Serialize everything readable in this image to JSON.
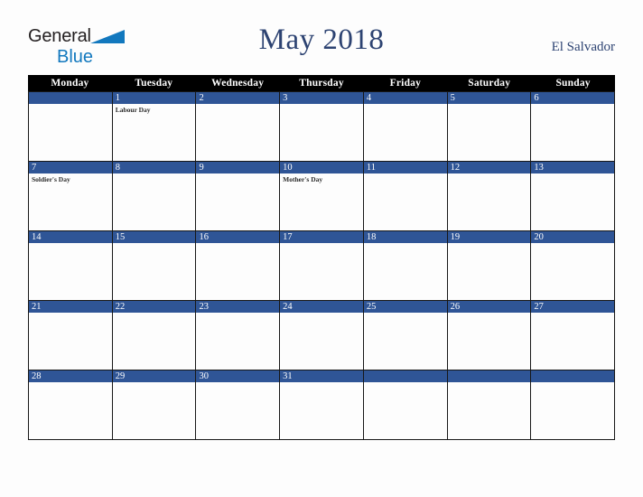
{
  "brand": {
    "word1": "General",
    "word2": "Blue",
    "color_dark": "#231f20",
    "color_blue": "#1278be",
    "triangle_icon": "triangle-icon"
  },
  "header": {
    "title": "May 2018",
    "country": "El Salvador",
    "title_color": "#2d4372"
  },
  "calendar": {
    "weekday_headers": [
      "Monday",
      "Tuesday",
      "Wednesday",
      "Thursday",
      "Friday",
      "Saturday",
      "Sunday"
    ],
    "header_bg": "#000000",
    "header_fg": "#ffffff",
    "daybar_bg": "#2f5596",
    "daybar_fg": "#ffffff",
    "cell_bg": "#fdfdfd",
    "grid_line": "#171717",
    "weeks": [
      [
        {
          "day": "",
          "events": []
        },
        {
          "day": "1",
          "events": [
            "Labour Day"
          ]
        },
        {
          "day": "2",
          "events": []
        },
        {
          "day": "3",
          "events": []
        },
        {
          "day": "4",
          "events": []
        },
        {
          "day": "5",
          "events": []
        },
        {
          "day": "6",
          "events": []
        }
      ],
      [
        {
          "day": "7",
          "events": [
            "Soldier's Day"
          ]
        },
        {
          "day": "8",
          "events": []
        },
        {
          "day": "9",
          "events": []
        },
        {
          "day": "10",
          "events": [
            "Mother's Day"
          ]
        },
        {
          "day": "11",
          "events": []
        },
        {
          "day": "12",
          "events": []
        },
        {
          "day": "13",
          "events": []
        }
      ],
      [
        {
          "day": "14",
          "events": []
        },
        {
          "day": "15",
          "events": []
        },
        {
          "day": "16",
          "events": []
        },
        {
          "day": "17",
          "events": []
        },
        {
          "day": "18",
          "events": []
        },
        {
          "day": "19",
          "events": []
        },
        {
          "day": "20",
          "events": []
        }
      ],
      [
        {
          "day": "21",
          "events": []
        },
        {
          "day": "22",
          "events": []
        },
        {
          "day": "23",
          "events": []
        },
        {
          "day": "24",
          "events": []
        },
        {
          "day": "25",
          "events": []
        },
        {
          "day": "26",
          "events": []
        },
        {
          "day": "27",
          "events": []
        }
      ],
      [
        {
          "day": "28",
          "events": []
        },
        {
          "day": "29",
          "events": []
        },
        {
          "day": "30",
          "events": []
        },
        {
          "day": "31",
          "events": []
        },
        {
          "day": "",
          "events": []
        },
        {
          "day": "",
          "events": []
        },
        {
          "day": "",
          "events": []
        }
      ]
    ]
  }
}
